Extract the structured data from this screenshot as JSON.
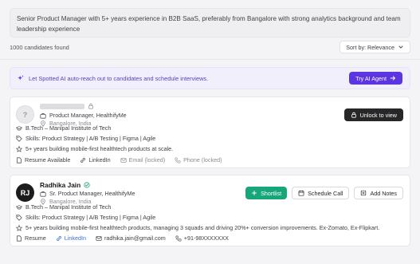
{
  "search": {
    "query": "Senior Product Manager with 5+ years experience in B2B SaaS, preferably from Bangalore with strong analytics background and team leadership experience"
  },
  "results": {
    "count_text": "1000 candidates found",
    "sort_label": "Sort by: Relevance"
  },
  "banner": {
    "text": "Let Spotted AI auto-reach out to candidates and schedule interviews.",
    "button_label": "Try AI Agent"
  },
  "candidates": [
    {
      "avatar": "?",
      "title": "Product Manager, HealthifyMe",
      "location": "Bangalore, India",
      "education": "B.Tech – Manipal Institute of Tech",
      "skills": "Skills: Product Strategy | A/B Testing | Figma | Agile",
      "summary": "5+ years building mobile-first healthtech products at scale.",
      "links": {
        "resume": "Resume Available",
        "linkedin": "LinkedIn",
        "email": "Email (locked)",
        "phone": "Phone (locked)"
      },
      "action_label": "Unlock to view"
    },
    {
      "avatar": "RJ",
      "name": "Radhika Jain",
      "title": "Sr. Product Manager, HealthifyMe",
      "location": "Bangalore, India",
      "education": "B.Tech – Manipal Institute of Tech",
      "skills": "Skills: Product Strategy | A/B Testing | Figma | Agile",
      "summary": "5+ years building mobile-first healthtech products, managing 3 squads and driving 20%+ conversion improvements. Ex-Zomato, Ex-Flipkart.",
      "links": {
        "resume": "Resume",
        "linkedin": "LinkedIn",
        "email": "radhika.jain@gmail.com",
        "phone": "+91-98XXXXXXX"
      },
      "actions": {
        "shortlist": "Shortlist",
        "schedule": "Schedule Call",
        "notes": "Add Notes"
      }
    }
  ],
  "colors": {
    "accent": "#5b35e0",
    "success": "#17a67a",
    "link": "#3b6fd4",
    "dark_button": "#27272a"
  },
  "icons": {
    "lock": "lock-icon",
    "sparkle": "sparkle-icon",
    "briefcase": "briefcase-icon",
    "location": "location-pin-icon",
    "education": "graduation-cap-icon",
    "skills": "tag-icon",
    "summary": "star-icon",
    "resume": "document-icon",
    "linkedin": "link-icon",
    "email": "mail-icon",
    "phone": "phone-icon",
    "verified": "verified-check-icon",
    "calendar": "calendar-icon",
    "notes": "notes-icon",
    "chevron": "chevron-down-icon",
    "arrow": "arrow-right-icon"
  }
}
